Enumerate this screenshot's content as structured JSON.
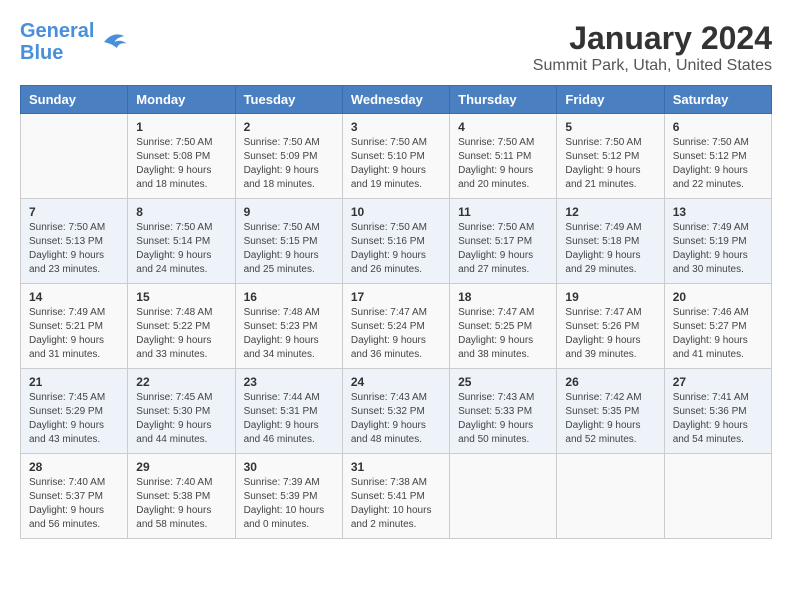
{
  "header": {
    "logo_line1": "General",
    "logo_line2": "Blue",
    "title": "January 2024",
    "subtitle": "Summit Park, Utah, United States"
  },
  "weekdays": [
    "Sunday",
    "Monday",
    "Tuesday",
    "Wednesday",
    "Thursday",
    "Friday",
    "Saturday"
  ],
  "weeks": [
    [
      {
        "day": "",
        "sunrise": "",
        "sunset": "",
        "daylight": ""
      },
      {
        "day": "1",
        "sunrise": "7:50 AM",
        "sunset": "5:08 PM",
        "daylight": "9 hours and 18 minutes."
      },
      {
        "day": "2",
        "sunrise": "7:50 AM",
        "sunset": "5:09 PM",
        "daylight": "9 hours and 18 minutes."
      },
      {
        "day": "3",
        "sunrise": "7:50 AM",
        "sunset": "5:10 PM",
        "daylight": "9 hours and 19 minutes."
      },
      {
        "day": "4",
        "sunrise": "7:50 AM",
        "sunset": "5:11 PM",
        "daylight": "9 hours and 20 minutes."
      },
      {
        "day": "5",
        "sunrise": "7:50 AM",
        "sunset": "5:12 PM",
        "daylight": "9 hours and 21 minutes."
      },
      {
        "day": "6",
        "sunrise": "7:50 AM",
        "sunset": "5:12 PM",
        "daylight": "9 hours and 22 minutes."
      }
    ],
    [
      {
        "day": "7",
        "sunrise": "7:50 AM",
        "sunset": "5:13 PM",
        "daylight": "9 hours and 23 minutes."
      },
      {
        "day": "8",
        "sunrise": "7:50 AM",
        "sunset": "5:14 PM",
        "daylight": "9 hours and 24 minutes."
      },
      {
        "day": "9",
        "sunrise": "7:50 AM",
        "sunset": "5:15 PM",
        "daylight": "9 hours and 25 minutes."
      },
      {
        "day": "10",
        "sunrise": "7:50 AM",
        "sunset": "5:16 PM",
        "daylight": "9 hours and 26 minutes."
      },
      {
        "day": "11",
        "sunrise": "7:50 AM",
        "sunset": "5:17 PM",
        "daylight": "9 hours and 27 minutes."
      },
      {
        "day": "12",
        "sunrise": "7:49 AM",
        "sunset": "5:18 PM",
        "daylight": "9 hours and 29 minutes."
      },
      {
        "day": "13",
        "sunrise": "7:49 AM",
        "sunset": "5:19 PM",
        "daylight": "9 hours and 30 minutes."
      }
    ],
    [
      {
        "day": "14",
        "sunrise": "7:49 AM",
        "sunset": "5:21 PM",
        "daylight": "9 hours and 31 minutes."
      },
      {
        "day": "15",
        "sunrise": "7:48 AM",
        "sunset": "5:22 PM",
        "daylight": "9 hours and 33 minutes."
      },
      {
        "day": "16",
        "sunrise": "7:48 AM",
        "sunset": "5:23 PM",
        "daylight": "9 hours and 34 minutes."
      },
      {
        "day": "17",
        "sunrise": "7:47 AM",
        "sunset": "5:24 PM",
        "daylight": "9 hours and 36 minutes."
      },
      {
        "day": "18",
        "sunrise": "7:47 AM",
        "sunset": "5:25 PM",
        "daylight": "9 hours and 38 minutes."
      },
      {
        "day": "19",
        "sunrise": "7:47 AM",
        "sunset": "5:26 PM",
        "daylight": "9 hours and 39 minutes."
      },
      {
        "day": "20",
        "sunrise": "7:46 AM",
        "sunset": "5:27 PM",
        "daylight": "9 hours and 41 minutes."
      }
    ],
    [
      {
        "day": "21",
        "sunrise": "7:45 AM",
        "sunset": "5:29 PM",
        "daylight": "9 hours and 43 minutes."
      },
      {
        "day": "22",
        "sunrise": "7:45 AM",
        "sunset": "5:30 PM",
        "daylight": "9 hours and 44 minutes."
      },
      {
        "day": "23",
        "sunrise": "7:44 AM",
        "sunset": "5:31 PM",
        "daylight": "9 hours and 46 minutes."
      },
      {
        "day": "24",
        "sunrise": "7:43 AM",
        "sunset": "5:32 PM",
        "daylight": "9 hours and 48 minutes."
      },
      {
        "day": "25",
        "sunrise": "7:43 AM",
        "sunset": "5:33 PM",
        "daylight": "9 hours and 50 minutes."
      },
      {
        "day": "26",
        "sunrise": "7:42 AM",
        "sunset": "5:35 PM",
        "daylight": "9 hours and 52 minutes."
      },
      {
        "day": "27",
        "sunrise": "7:41 AM",
        "sunset": "5:36 PM",
        "daylight": "9 hours and 54 minutes."
      }
    ],
    [
      {
        "day": "28",
        "sunrise": "7:40 AM",
        "sunset": "5:37 PM",
        "daylight": "9 hours and 56 minutes."
      },
      {
        "day": "29",
        "sunrise": "7:40 AM",
        "sunset": "5:38 PM",
        "daylight": "9 hours and 58 minutes."
      },
      {
        "day": "30",
        "sunrise": "7:39 AM",
        "sunset": "5:39 PM",
        "daylight": "10 hours and 0 minutes."
      },
      {
        "day": "31",
        "sunrise": "7:38 AM",
        "sunset": "5:41 PM",
        "daylight": "10 hours and 2 minutes."
      },
      {
        "day": "",
        "sunrise": "",
        "sunset": "",
        "daylight": ""
      },
      {
        "day": "",
        "sunrise": "",
        "sunset": "",
        "daylight": ""
      },
      {
        "day": "",
        "sunrise": "",
        "sunset": "",
        "daylight": ""
      }
    ]
  ],
  "labels": {
    "sunrise_prefix": "Sunrise: ",
    "sunset_prefix": "Sunset: ",
    "daylight_prefix": "Daylight: "
  }
}
